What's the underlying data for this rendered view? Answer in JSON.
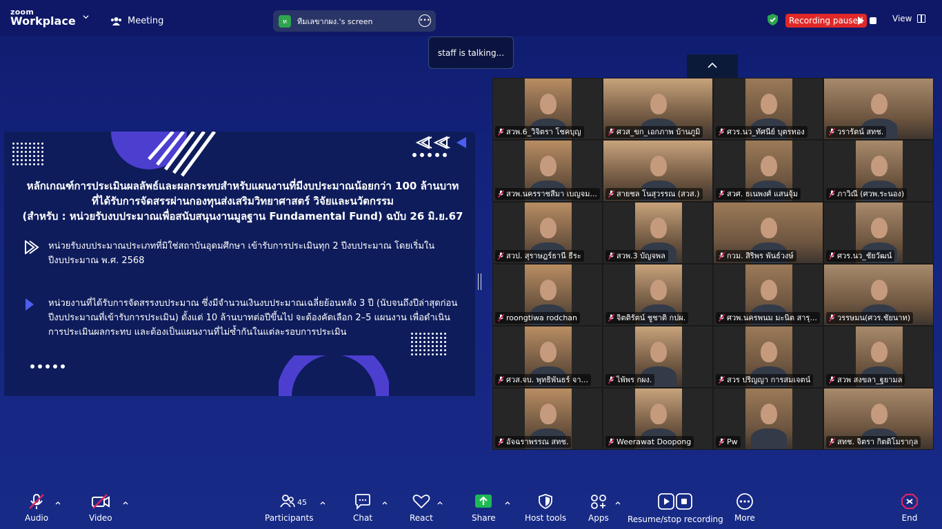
{
  "app": {
    "brand_top": "zoom",
    "brand_bottom": "Workplace"
  },
  "topbar": {
    "meeting_label": "Meeting",
    "share_badge": "ท",
    "share_label": "ทีมเลขากผง.'s screen",
    "talking": "staff is talking...",
    "recording_label": "Recording paused",
    "view_label": "View",
    "colors": {
      "recording": "#e02828",
      "secure": "#2ea44f"
    }
  },
  "slide": {
    "title_lines": [
      "หลักเกณฑ์การประเมินผลลัพธ์และผลกระทบสำหรับแผนงานที่มีงบประมาณน้อยกว่า 100 ล้านบาท",
      "ที่ได้รับการจัดสรรผ่านกองทุนส่งเสริมวิทยาศาสตร์ วิจัยและนวัตกรรม",
      "(สำหรับ : หน่วยรับงบประมาณเพื่อสนับสนุนงานมูลฐาน Fundamental Fund) ฉบับ 26 มิ.ย.67"
    ],
    "bullets": [
      "หน่วยรับงบประมาณประเภทที่มิใช่สถาบันอุดมศึกษา เข้ารับการประเมินทุก 2 ปีงบประมาณ โดยเริ่มในปีงบประมาณ พ.ศ. 2568",
      "หน่วยงานที่ได้รับการจัดสรรงบประมาณ ซึ่งมีจำนวนเงินงบประมาณเฉลี่ยย้อนหลัง 3 ปี (นับจนถึงปีล่าสุดก่อนปีงบประมาณที่เข้ารับการประเมิน) ตั้งแต่ 10 ล้านบาทต่อปีขึ้นไป จะต้องคัดเลือก 2–5 แผนงาน เพื่อดำเนินการประเมินผลกระทบ และต้องเป็นแผนงานที่ไม่ซ้ำกันในแต่ละรอบการประเมิน"
    ]
  },
  "participants": [
    "สวพ.6_วิจิตรา โชคบุญ",
    "ศวส_ขก_เอกภาพ บ้านภูมิ",
    "ศวร.นว_ทัศนีย์ บุตรทอง",
    "วรารัตน์ สทช.",
    "สวพ.นครราชสีมา เบญจม...",
    "สายชล โนสุวรรณ (สวส.)",
    "สวศ. ธเนพงศ์ แสนจุ้ม",
    "ภาวิณี (ศวพ.ระนอง)",
    "สวป. สุราษฎร์ธานี ธีระ",
    "สวพ.3 บัญจพล",
    "กวม. สิริพร พันธ์วงษ์",
    "ศวร.นว_ชัยวัฒน์",
    "roongtiwa rodchan",
    "จิตติรัตน์ ชูชาติ กปผ.",
    "ศวพ.นครพนม มะนิต สารุ...",
    "วรรษมน(ศวร.ชัยนาท)",
    "ศวส.จบ. พุทธิพันธร์ จา...",
    "ไพ้พร กผง.",
    "สวร ปริญญา การสมเจตน์",
    "สวพ สงขลา_ฐยามล",
    "อัจฉราพรรณ สทช.",
    "Weerawat Doopong",
    "Pw",
    "สทช. จิตรา กิตติโมรากุล"
  ],
  "toolbar": {
    "audio": "Audio",
    "video": "Video",
    "participants": "Participants",
    "participants_count": "45",
    "chat": "Chat",
    "react": "React",
    "share": "Share",
    "host_tools": "Host tools",
    "apps": "Apps",
    "record": "Resume/stop recording",
    "more": "More",
    "end": "End",
    "colors": {
      "share": "#1db954",
      "end": "#e0245e",
      "muted": "#e0245e"
    }
  }
}
